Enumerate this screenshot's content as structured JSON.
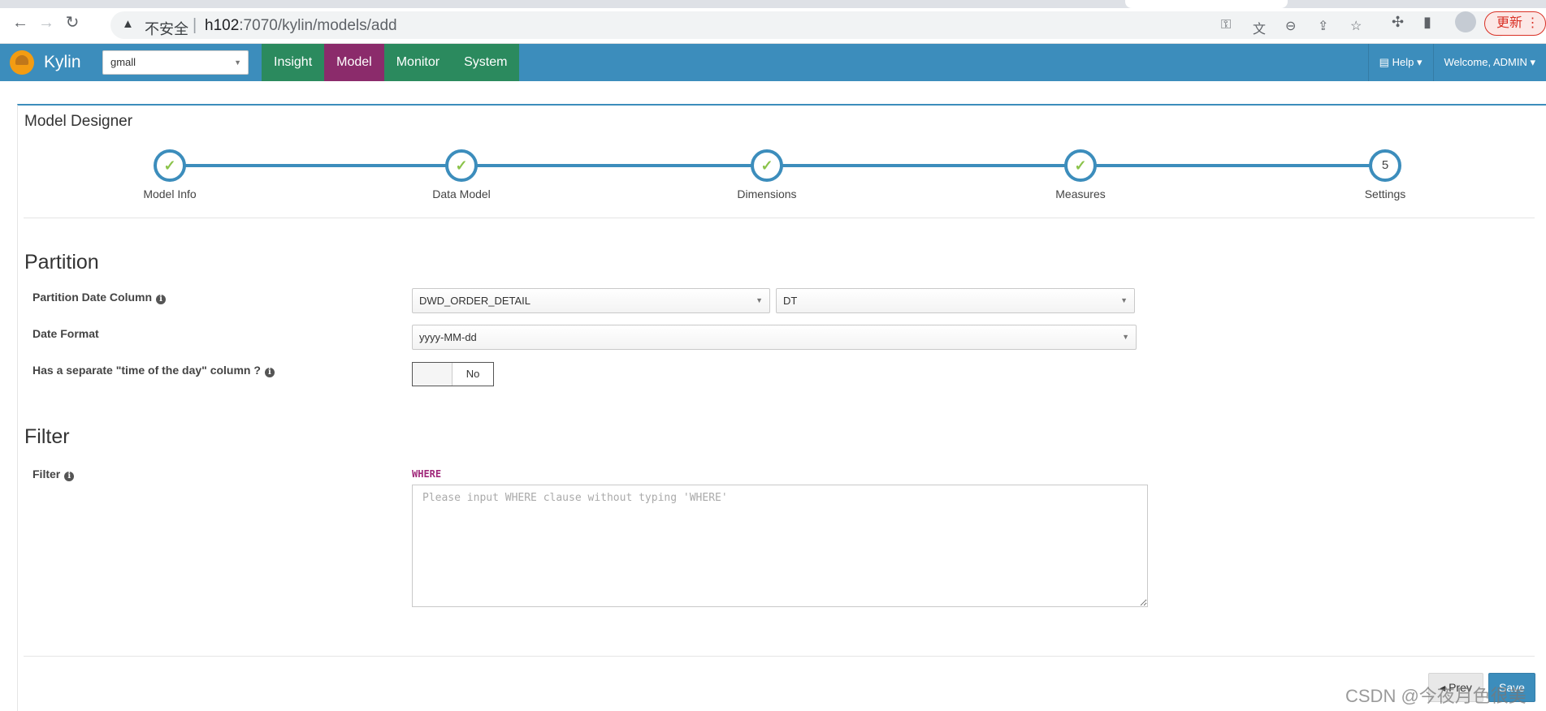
{
  "browser": {
    "insecure_label": "不安全",
    "url_host": "h102",
    "url_rest": ":7070/kylin/models/add",
    "update_label": "更新"
  },
  "navbar": {
    "brand": "Kylin",
    "project": "gmall",
    "menu": [
      "Insight",
      "Model",
      "Monitor",
      "System"
    ],
    "active_menu": "Model",
    "help": "Help",
    "welcome": "Welcome, ADMIN"
  },
  "page": {
    "title": "Model Designer"
  },
  "wizard": {
    "steps": [
      {
        "label": "Model Info",
        "done": true
      },
      {
        "label": "Data Model",
        "done": true
      },
      {
        "label": "Dimensions",
        "done": true
      },
      {
        "label": "Measures",
        "done": true
      },
      {
        "label": "Settings",
        "done": false,
        "number": "5"
      }
    ]
  },
  "partition": {
    "heading": "Partition",
    "date_column_label": "Partition Date Column",
    "table_value": "DWD_ORDER_DETAIL",
    "column_value": "DT",
    "date_format_label": "Date Format",
    "date_format_value": "yyyy-MM-dd",
    "separate_time_label": "Has a separate \"time of the day\" column ?",
    "separate_time_value": "No"
  },
  "filter": {
    "heading": "Filter",
    "label": "Filter",
    "where_keyword": "WHERE",
    "placeholder": "Please input WHERE clause without typing 'WHERE'"
  },
  "actions": {
    "prev": "Prev",
    "save": "Save"
  },
  "watermark": "CSDN @今夜月色很美",
  "colors": {
    "navbar": "#3c8dbc",
    "menu_bg": "#2b8a5e",
    "menu_active": "#8b2b6b",
    "check": "#8bc34a"
  }
}
